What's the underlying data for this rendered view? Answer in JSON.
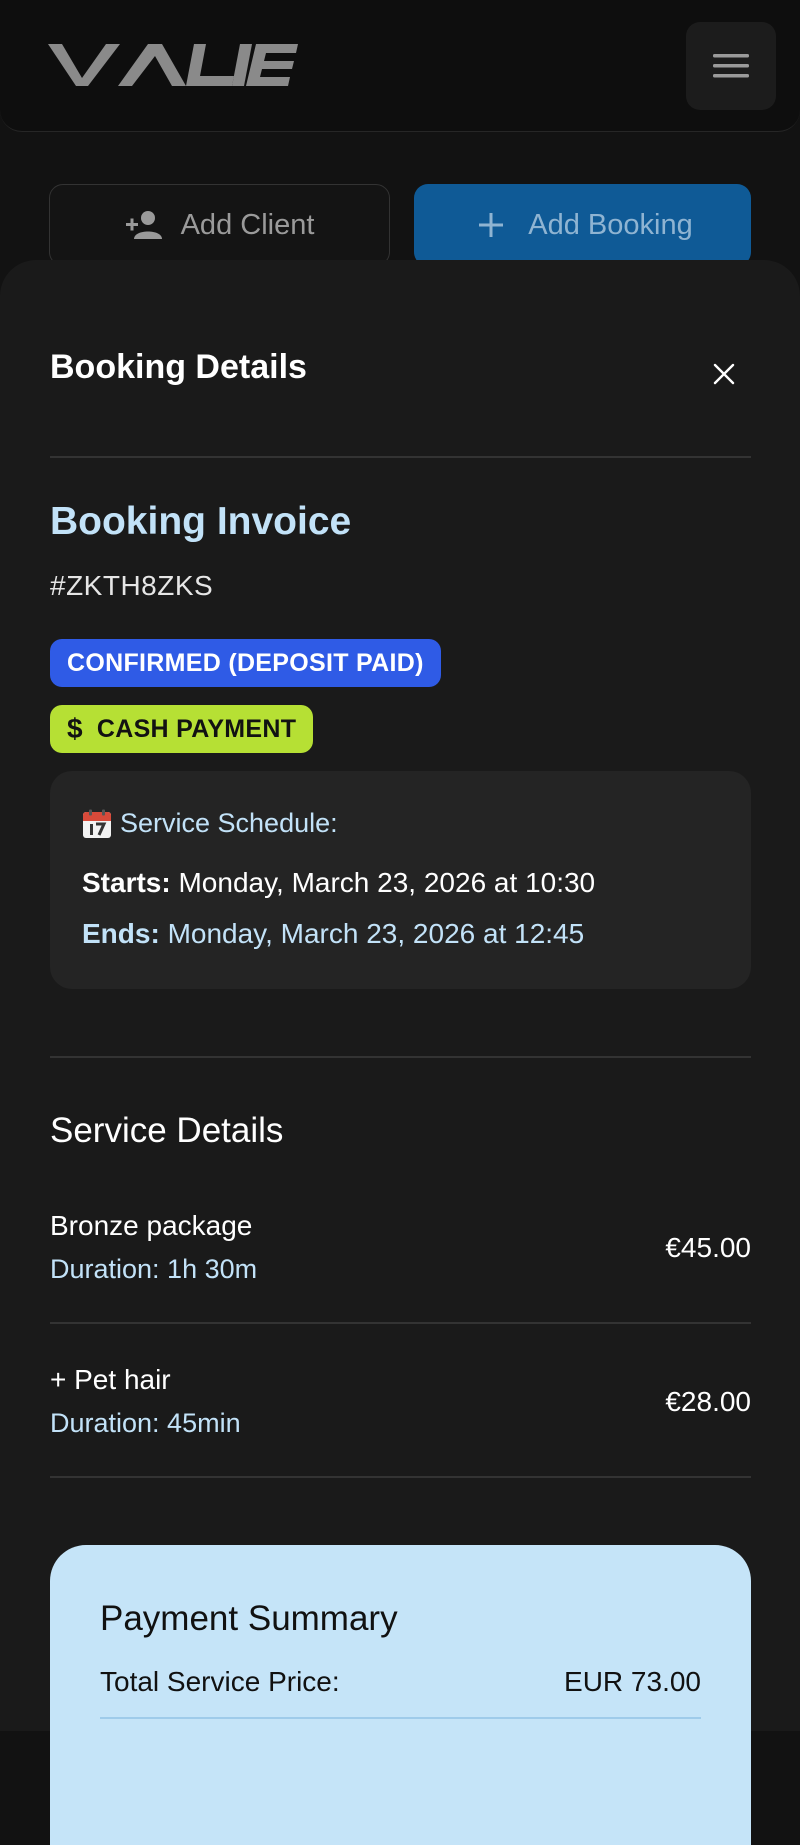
{
  "app": {
    "logo_text": "VALIE",
    "add_client_label": "Add Client",
    "add_booking_label": "Add Booking"
  },
  "sheet": {
    "title": "Booking Details",
    "invoice_title": "Booking Invoice",
    "invoice_id": "#ZKTH8ZKS",
    "status_badge": "CONFIRMED (DEPOSIT PAID)",
    "payment_badge_symbol": "$",
    "payment_badge": "CASH PAYMENT",
    "schedule": {
      "heading": "Service Schedule:",
      "starts_label": "Starts:",
      "starts_value": "Monday, March 23, 2026 at 10:30",
      "ends_label": "Ends:",
      "ends_value": "Monday, March 23, 2026 at 12:45"
    },
    "service_details": {
      "title": "Service Details",
      "items": [
        {
          "name": "Bronze package",
          "duration": "Duration: 1h 30m",
          "price": "€45.00"
        },
        {
          "name": "+ Pet hair",
          "duration": "Duration: 45min",
          "price": "€28.00"
        }
      ]
    },
    "payment_summary": {
      "title": "Payment Summary",
      "total_label": "Total Service Price:",
      "total_value": "EUR 73.00"
    }
  },
  "colors": {
    "accent_light_blue": "#c2e2f8",
    "confirmed_badge": "#2f5be6",
    "cash_badge": "#b6e034",
    "booking_button": "#0f5a96",
    "payment_card": "#c5e4f8"
  }
}
